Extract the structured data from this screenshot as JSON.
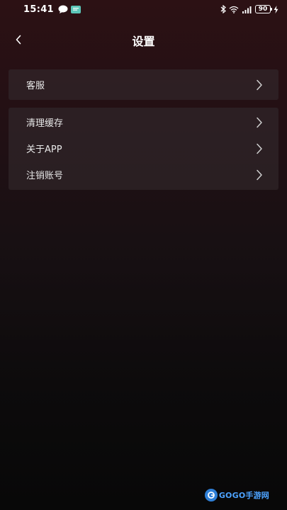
{
  "status_bar": {
    "time": "15:41",
    "battery": "90"
  },
  "header": {
    "title": "设置"
  },
  "groups": [
    {
      "items": [
        {
          "label": "客服"
        }
      ]
    },
    {
      "items": [
        {
          "label": "清理缓存"
        },
        {
          "label": "关于APP"
        },
        {
          "label": "注销账号"
        }
      ]
    }
  ],
  "watermark": {
    "text": "GOGO手游网"
  },
  "icons": {
    "back": "chevron-left-icon",
    "row": "chevron-right-icon",
    "chat": "chat-bubble-icon",
    "bluetooth": "bluetooth-icon",
    "wifi": "wifi-icon",
    "signal": "signal-icon",
    "charging": "lightning-icon"
  },
  "colors": {
    "card_background": "#342c2f",
    "text": "#e8e8e8",
    "watermark": "#4da3ff"
  }
}
